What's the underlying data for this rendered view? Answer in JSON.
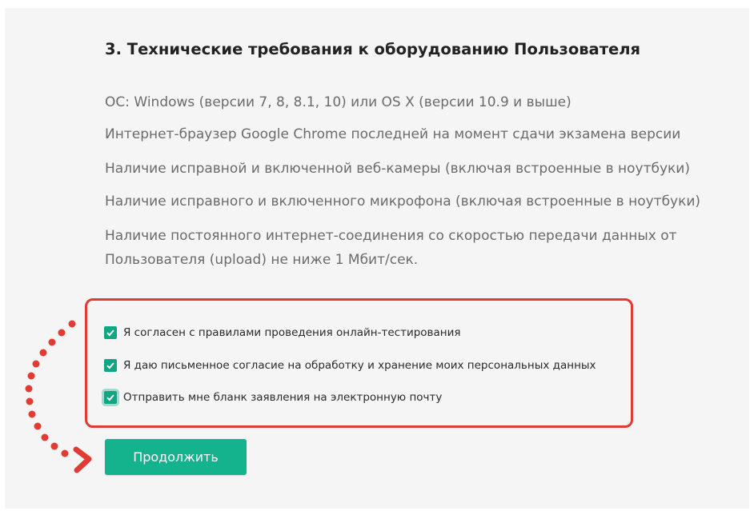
{
  "section": {
    "heading": "3. Технические требования к оборудованию Пользователя",
    "requirements": [
      "ОС: Windows (версии 7, 8, 8.1, 10) или OS X (версии 10.9 и выше)",
      "Интернет-браузер Google Chrome последней на момент сдачи экзамена версии",
      "Наличие исправной и включенной веб-камеры (включая встроенные в ноутбуки)",
      "Наличие исправного и включенного микрофона (включая встроенные в ноутбуки)",
      "Наличие постоянного интернет-соединения со скоростью передачи данных от Пользователя (upload) не ниже 1 Мбит/сек."
    ]
  },
  "consents": [
    {
      "label": "Я согласен с правилами проведения онлайн-тестирования",
      "checked": true
    },
    {
      "label": "Я даю письменное согласие на обработку и хранение моих персональных данных",
      "checked": true
    },
    {
      "label": "Отправить мне бланк заявления на электронную почту",
      "checked": true
    }
  ],
  "continue_button": {
    "label": "Продолжить"
  },
  "colors": {
    "accent": "#15b28e",
    "highlight": "#e23b34",
    "background": "#f5f5f5"
  },
  "icons": [
    "checkmark-icon",
    "dotted-arrow-icon"
  ]
}
